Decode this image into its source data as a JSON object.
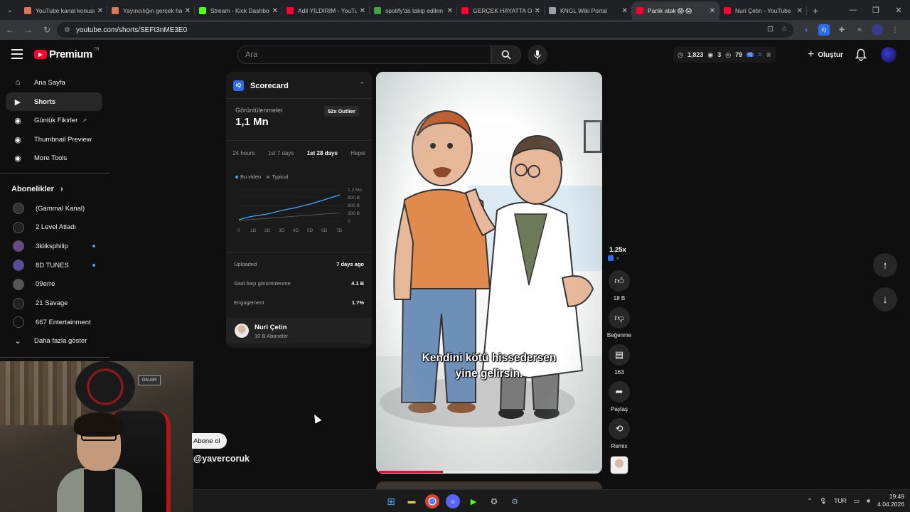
{
  "browser": {
    "tabs": [
      {
        "title": "YouTube kanal konusu",
        "icon": "claude-icon",
        "color": "#d97757"
      },
      {
        "title": "Yayıncılığın gerçek hali",
        "icon": "claude-icon",
        "color": "#d97757"
      },
      {
        "title": "Stream - Kick Dashboard",
        "icon": "kick-icon",
        "color": "#53fc18"
      },
      {
        "title": "Adil YILDIRIM - YouTube",
        "icon": "youtube-icon",
        "color": "#ff0033"
      },
      {
        "title": "spotify'da takip edilen",
        "icon": "leaf-icon",
        "color": "#43a047"
      },
      {
        "title": "GERÇEK HAYATTA OYUN",
        "icon": "youtube-icon",
        "color": "#ff0033"
      },
      {
        "title": "KNGL Wiki Portal",
        "icon": "globe-icon",
        "color": "#9aa0a6"
      },
      {
        "title": "Panik atak 😱 😱",
        "icon": "youtube-icon",
        "color": "#ff0033",
        "active": true
      },
      {
        "title": "Nuri Çetin - YouTube",
        "icon": "youtube-icon",
        "color": "#ff0033"
      }
    ],
    "url": "youtube.com/shorts/SEFt3nME3E0"
  },
  "header": {
    "logo_word": "Premium",
    "logo_region": "TR",
    "search_placeholder": "Ara",
    "stats": {
      "views": "1,823",
      "a": "3",
      "b": "79"
    },
    "create_label": "Oluştur"
  },
  "sidebar": {
    "items": [
      {
        "label": "Ana Sayfa",
        "icon": "home-icon"
      },
      {
        "label": "Shorts",
        "icon": "shorts-icon",
        "active": true
      },
      {
        "label": "Günlük Fikirler",
        "icon": "bulb-icon"
      },
      {
        "label": "Thumbnail Preview",
        "icon": "image-icon"
      },
      {
        "label": "More Tools",
        "icon": "tools-icon"
      }
    ],
    "subscriptions_title": "Abonelikler",
    "channels": [
      {
        "label": "(Gammal Kanal)",
        "dot": false
      },
      {
        "label": "2 Level Atladı",
        "dot": false
      },
      {
        "label": "3kliksphilip",
        "dot": true
      },
      {
        "label": "8D TUNES",
        "dot": true
      },
      {
        "label": "09erre",
        "dot": false
      },
      {
        "label": "21 Savage",
        "dot": false
      },
      {
        "label": "667 Entertainment",
        "dot": false
      }
    ],
    "show_more": "Daha fazla göster"
  },
  "scorecard": {
    "title": "Scorecard",
    "views_label": "Görüntülenmeler",
    "views": "1,1 Mn",
    "outlier": "52x Outlier",
    "tabs": [
      "24 hours",
      "1st 7 days",
      "1st 28 days",
      "Hepsi"
    ],
    "active_tab": 2,
    "legend": [
      "Bu video",
      "Typical"
    ],
    "chart_y_labels": [
      "1.2 Mn",
      "900 B",
      "600 B",
      "300 B",
      "0"
    ],
    "chart_x_labels": [
      "0",
      "1D",
      "2D",
      "3D",
      "4D",
      "5D",
      "6D",
      "7D"
    ],
    "uploaded_label": "Uploaded",
    "uploaded_value": "7 days ago",
    "hourly_label": "Saat başı görüntülenme",
    "hourly_value": "4.1 B",
    "engagement_label": "Engagement",
    "engagement_value": "1.7%",
    "channel_name": "Nuri Çetin",
    "channel_subs": "10 B Aboneler"
  },
  "player": {
    "subtitle_line1": "Kendini kötü hissedersen",
    "subtitle_line2": "yine gelirsin.",
    "progress": 0.29
  },
  "actions": {
    "speed": "1.25x",
    "likes": "18 B",
    "dislike_label": "Beğenme",
    "comments": "163",
    "share_label": "Paylaş",
    "remix_label": "Remix"
  },
  "overlay": {
    "subscribe_label": "Abone ol",
    "handle": "@yavercoruk",
    "onair": "ON AIR"
  },
  "taskbar": {
    "lang": "TUR",
    "time": "19:49",
    "date": "4.04.2026"
  }
}
